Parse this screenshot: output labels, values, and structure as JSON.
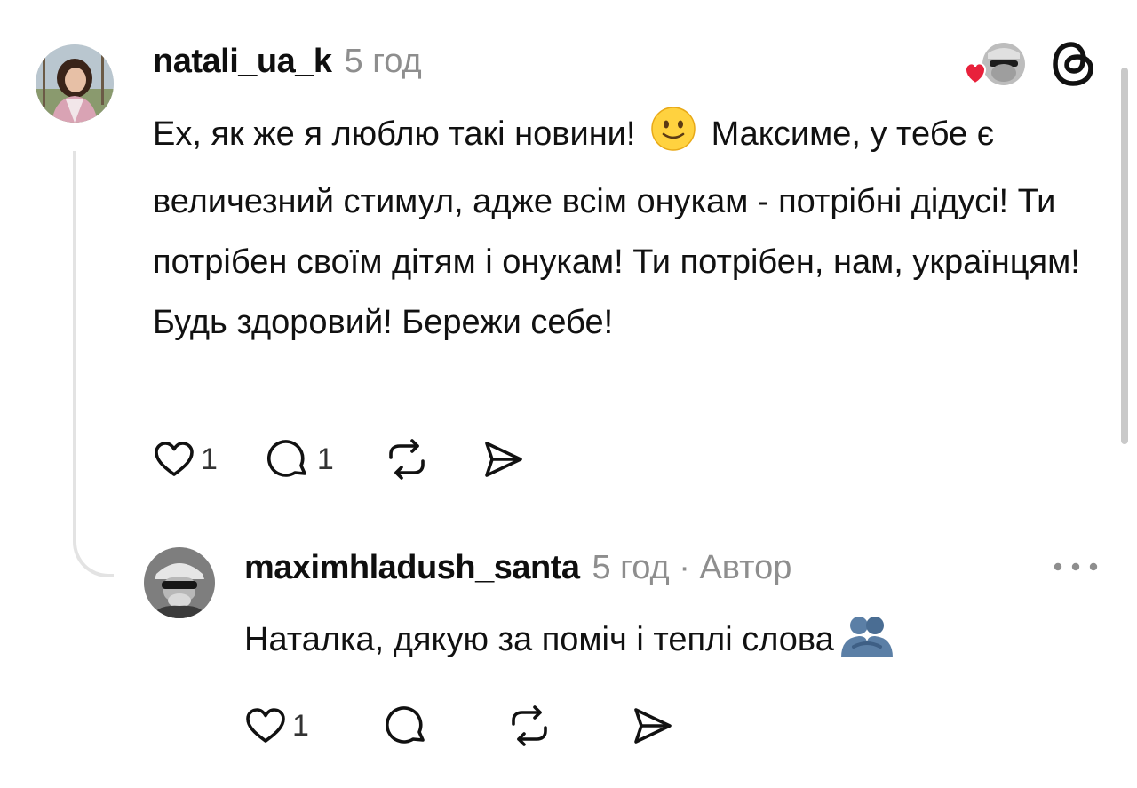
{
  "comment": {
    "author": "natali_ua_k",
    "time": "5 год",
    "text_before_emoji": "Ех, як же я люблю такі новини!",
    "emoji": "slightly-smiling-face",
    "text_after_emoji": "Максиме, у тебе є величезний стимул, адже всім онукам - потрібні дідусі! Ти потрібен своїм дітям і онукам! Ти потрібен, нам, українцям! Будь здоровий! Бережи себе!",
    "likes": "1",
    "replies": "1"
  },
  "reply": {
    "author": "maximhladush_santa",
    "meta": "5 год · Автор",
    "text": "Наталка, дякую за поміч і теплі слова",
    "emoji": "people-hugging",
    "likes": "1"
  },
  "icons": {
    "like": "heart-icon",
    "reply": "comment-icon",
    "repost": "repost-icon",
    "share": "send-icon",
    "brand": "threads-logo-icon",
    "menu": "more-horizontal-icon"
  },
  "colors": {
    "text": "#111111",
    "muted": "#8e8e8e",
    "heart": "#e8213b",
    "thread_line": "#e3e3e3"
  }
}
